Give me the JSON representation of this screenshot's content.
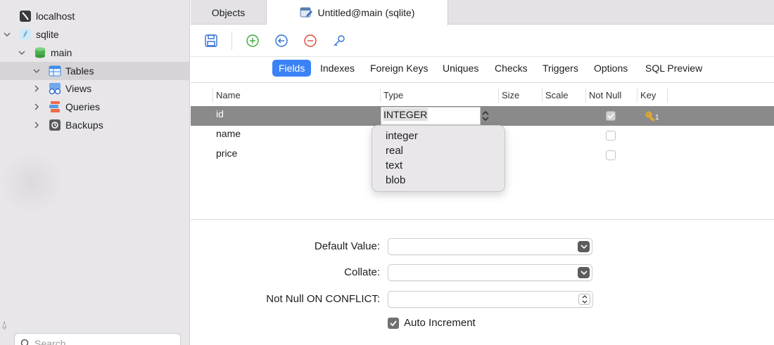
{
  "sidebar": {
    "connection": "localhost",
    "database": "sqlite",
    "schema": "main",
    "groups": [
      {
        "label": "Tables"
      },
      {
        "label": "Views"
      },
      {
        "label": "Queries"
      },
      {
        "label": "Backups"
      }
    ],
    "search_placeholder": "Search",
    "search_value": ""
  },
  "tabs": {
    "objects": "Objects",
    "active": "Untitled@main (sqlite)"
  },
  "subtabs": [
    "Fields",
    "Indexes",
    "Foreign Keys",
    "Uniques",
    "Checks",
    "Triggers",
    "Options",
    "SQL Preview"
  ],
  "grid": {
    "columns": [
      "Name",
      "Type",
      "Size",
      "Scale",
      "Not Null",
      "Key"
    ],
    "rows": [
      {
        "name": "id",
        "type": "INTEGER",
        "key_index": "1"
      },
      {
        "name": "name",
        "type": ""
      },
      {
        "name": "price",
        "type": ""
      }
    ]
  },
  "type_options": [
    "integer",
    "real",
    "text",
    "blob"
  ],
  "properties": {
    "default_value_label": "Default Value:",
    "collate_label": "Collate:",
    "not_null_conflict_label": "Not Null ON CONFLICT:",
    "auto_increment_label": "Auto Increment"
  },
  "colors": {
    "accent": "#3b82f6",
    "selected_row": "#8a8a8a",
    "key_icon": "#e0a82e"
  }
}
